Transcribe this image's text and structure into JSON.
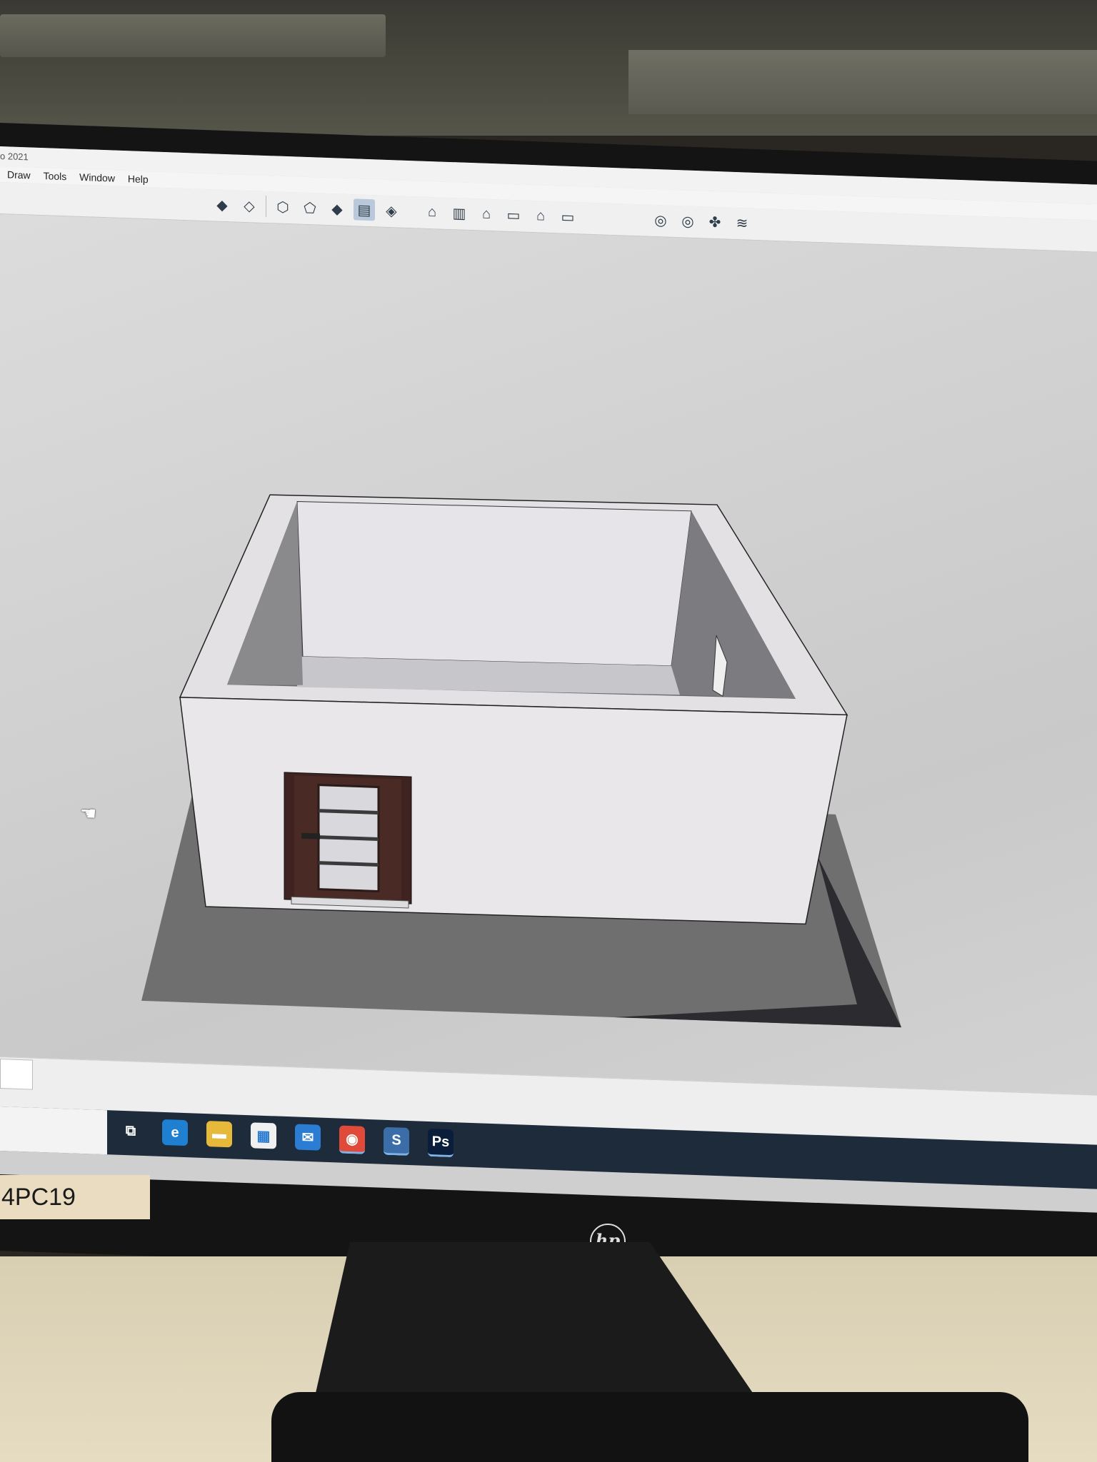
{
  "app": {
    "window_title": "o 2021",
    "menu": [
      "Draw",
      "Tools",
      "Window",
      "Help"
    ]
  },
  "toolbar": {
    "group_styles": [
      "xray-icon",
      "back-edges-icon",
      "wireframe-icon",
      "hidden-line-icon",
      "shaded-icon",
      "shaded-textures-icon",
      "monochrome-icon"
    ],
    "active_style": "shaded-textures-icon",
    "group_views": [
      "iso-view-icon",
      "top-view-icon",
      "front-view-icon",
      "right-view-icon",
      "back-view-icon",
      "left-view-icon"
    ],
    "group_extensions": [
      "warehouse-icon",
      "share-model-icon",
      "extension-warehouse-icon",
      "layout-icon"
    ]
  },
  "model": {
    "description_colors": {
      "wall": "#e9e7ea",
      "shadow": "#6e6e6e",
      "door_frame": "#4a2a24",
      "door_glass": "#d9d9dd"
    }
  },
  "taskbar": {
    "apps": [
      {
        "name": "task-view-icon",
        "glyph": "⧉",
        "color": "#1d2b3a",
        "running": false
      },
      {
        "name": "edge-icon",
        "glyph": "e",
        "color": "#1f7fd0",
        "running": false
      },
      {
        "name": "file-explorer-icon",
        "glyph": "▬",
        "color": "#e6b93a",
        "running": false
      },
      {
        "name": "store-icon",
        "glyph": "▦",
        "color": "#f0f0f0",
        "running": false
      },
      {
        "name": "mail-icon",
        "glyph": "✉",
        "color": "#2b7cd3",
        "running": false
      },
      {
        "name": "chrome-icon",
        "glyph": "◉",
        "color": "#e04a3a",
        "running": true
      },
      {
        "name": "sketchup-icon",
        "glyph": "S",
        "color": "#3b6ea8",
        "running": true
      },
      {
        "name": "photoshop-icon",
        "glyph": "Ps",
        "color": "#0a1e3c",
        "running": true
      }
    ]
  },
  "label_sticker": "4PC19",
  "monitor_brand": "hp"
}
